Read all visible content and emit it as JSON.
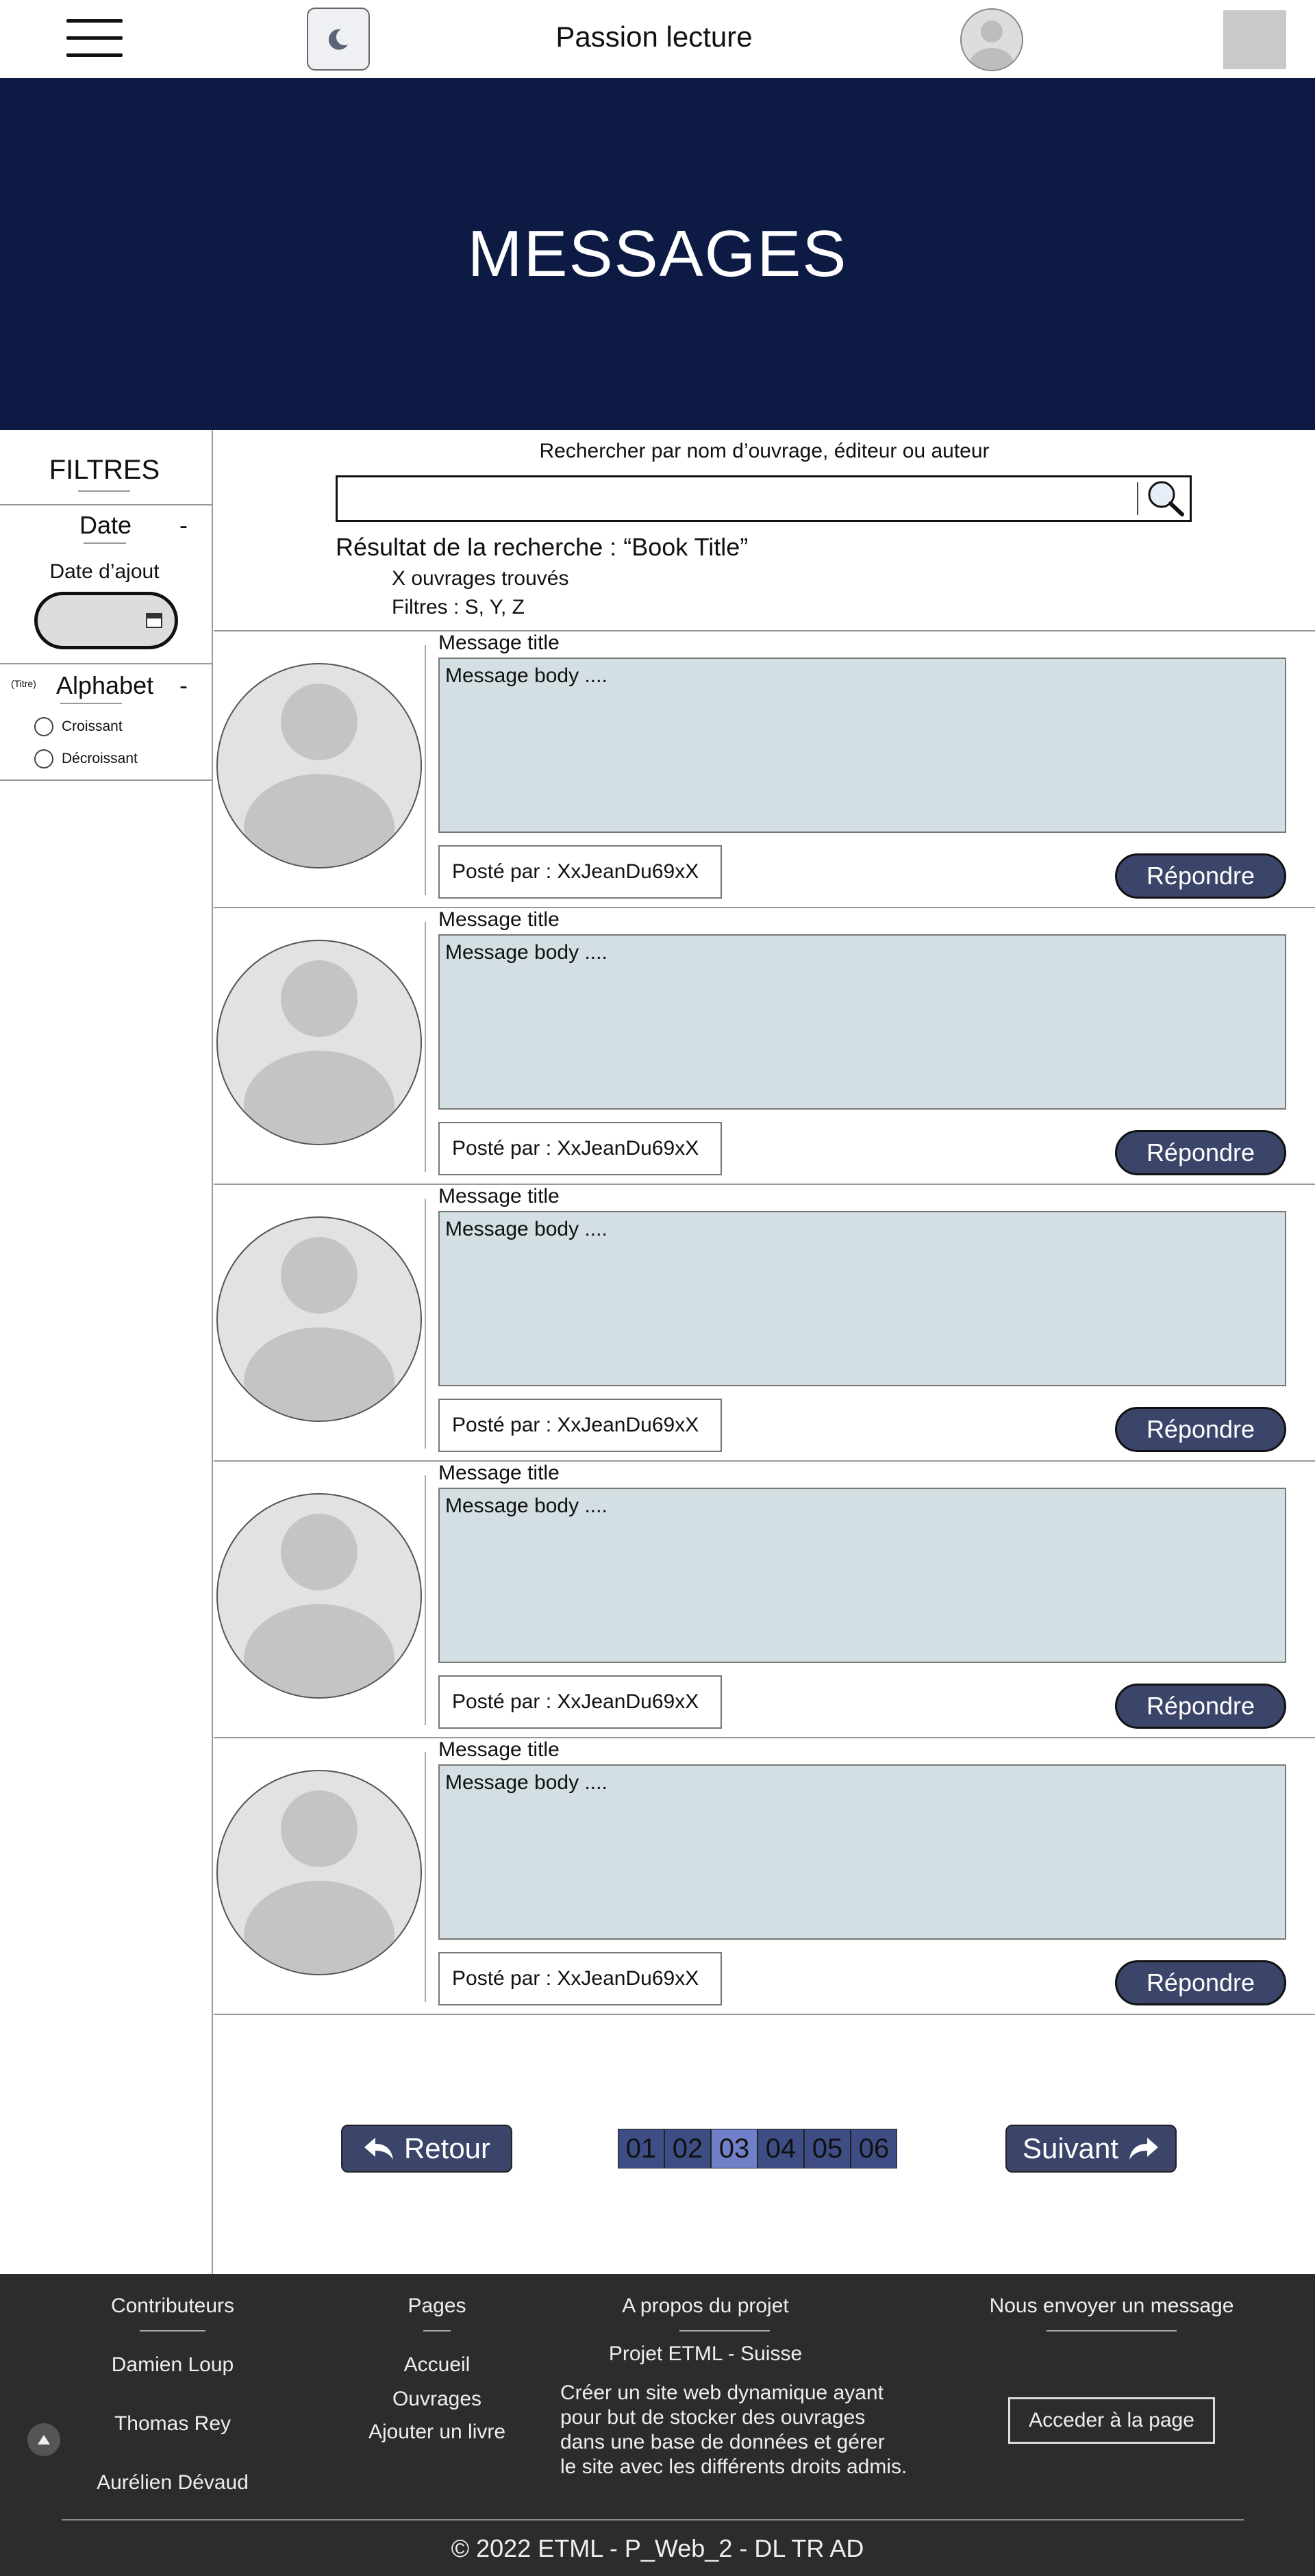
{
  "header": {
    "site_title": "Passion lecture",
    "menu_icon": "hamburger-menu-icon",
    "theme_icon": "moon-icon",
    "profile_icon": "user-avatar-icon"
  },
  "banner": {
    "title": "MESSAGES",
    "background": "#0c1a44"
  },
  "sidebar": {
    "title": "FILTRES",
    "date": {
      "label": "Date",
      "toggle": "-",
      "field_label": "Date d’ajout"
    },
    "alphabet": {
      "prefix": "(Titre)",
      "label": "Alphabet",
      "toggle": "-",
      "options": [
        "Croissant",
        "Décroissant"
      ]
    }
  },
  "search": {
    "label": "Rechercher par nom d’ouvrage, éditeur ou auteur",
    "value": "",
    "result_title": "Résultat de la recherche : “Book Title”",
    "result_count": "X ouvrages trouvés",
    "result_filters": "Filtres : S, Y, Z"
  },
  "messages": [
    {
      "title": "Message title",
      "body": "Message body ....",
      "poster": "Posté par : XxJeanDu69xX",
      "reply_label": "Répondre"
    },
    {
      "title": "Message title",
      "body": "Message body ....",
      "poster": "Posté par : XxJeanDu69xX",
      "reply_label": "Répondre"
    },
    {
      "title": "Message title",
      "body": "Message body ....",
      "poster": "Posté par : XxJeanDu69xX",
      "reply_label": "Répondre"
    },
    {
      "title": "Message title",
      "body": "Message body ....",
      "poster": "Posté par : XxJeanDu69xX",
      "reply_label": "Répondre"
    },
    {
      "title": "Message title",
      "body": "Message body ....",
      "poster": "Posté par : XxJeanDu69xX",
      "reply_label": "Répondre"
    }
  ],
  "pagination": {
    "prev_label": "Retour",
    "next_label": "Suivant",
    "pages": [
      "01",
      "02",
      "03",
      "04",
      "05",
      "06"
    ],
    "current": "03"
  },
  "footer": {
    "contributors": {
      "title": "Contributeurs",
      "names": [
        "Damien Loup",
        "Thomas Rey",
        "Aurélien Dévaud"
      ]
    },
    "pages": {
      "title": "Pages",
      "links": [
        "Accueil",
        "Ouvrages",
        "Ajouter un livre"
      ]
    },
    "about": {
      "title": "A propos du projet",
      "subtitle": "Projet ETML - Suisse",
      "description_lines": [
        "Créer un site web dynamique ayant",
        "pour but de stocker des ouvrages",
        "dans une base de données et gérer",
        "le site avec les différents droits admis."
      ]
    },
    "contact": {
      "title": "Nous envoyer un message",
      "button_label": "Acceder à la page"
    },
    "copyright": "© 2022 ETML - P_Web_2 - DL TR AD"
  }
}
